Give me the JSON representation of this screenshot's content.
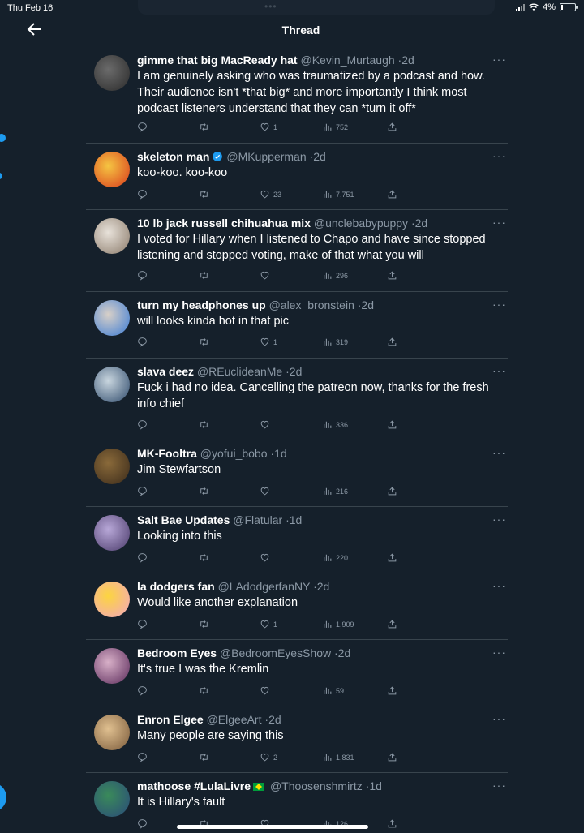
{
  "status_bar": {
    "time": "Thu Feb 16",
    "battery": "4%"
  },
  "header": {
    "title": "Thread"
  },
  "colors": {
    "background": "#15202b",
    "accent": "#1d9bf0",
    "muted": "#8b98a5",
    "divider": "#38444d"
  },
  "tweets": [
    {
      "name": "gimme that big MacReady hat",
      "handle": "@Kevin_Murtaugh",
      "time": "2d",
      "text": "I am genuinely asking who was traumatized by a podcast and how. Their audience isn't *that big* and more importantly I think most podcast listeners understand that they can *turn it off*",
      "likes": "1",
      "views": "752",
      "avatar_colors": [
        "#6b6b6b",
        "#2a2a2a"
      ]
    },
    {
      "name": "skeleton man",
      "verified": true,
      "handle": "@MKupperman",
      "time": "2d",
      "text": "koo-koo. koo-koo",
      "likes": "23",
      "views": "7,751",
      "avatar_colors": [
        "#f5c542",
        "#d93a1c"
      ]
    },
    {
      "name": "10 lb jack russell chihuahua mix",
      "handle": "@unclebabypuppy",
      "time": "2d",
      "text": "I voted for Hillary when I listened to Chapo and have since stopped listening and stopped voting, make of that what you will",
      "likes": "",
      "views": "296",
      "avatar_colors": [
        "#e8e2da",
        "#8a7a6a"
      ]
    },
    {
      "name": "turn my headphones up",
      "handle": "@alex_bronstein",
      "time": "2d",
      "text": "will looks kinda hot in that pic",
      "likes": "1",
      "views": "319",
      "avatar_colors": [
        "#d8d0c8",
        "#3a7bd5"
      ]
    },
    {
      "name": "slava deez",
      "handle": "@REuclideanMe",
      "time": "2d",
      "text": "Fuck i had no idea. Cancelling the patreon now, thanks for the fresh info chief",
      "likes": "",
      "views": "336",
      "avatar_colors": [
        "#c9d6df",
        "#2e4a6b"
      ]
    },
    {
      "name": "MK-Fooltra",
      "handle": "@yofui_bobo",
      "time": "1d",
      "text": "Jim Stewfartson",
      "likes": "",
      "views": "216",
      "avatar_colors": [
        "#8a6a3a",
        "#3a2a1a"
      ]
    },
    {
      "name": "Salt Bae Updates",
      "handle": "@Flatular",
      "time": "1d",
      "text": "Looking into this",
      "likes": "",
      "views": "220",
      "avatar_colors": [
        "#b8a8d8",
        "#4a3a6a"
      ]
    },
    {
      "name": "la dodgers fan",
      "handle": "@LAdodgerfanNY",
      "time": "2d",
      "text": "Would like another explanation",
      "likes": "1",
      "views": "1,909",
      "avatar_colors": [
        "#fcd53f",
        "#f3a6c0"
      ]
    },
    {
      "name": "Bedroom Eyes",
      "handle": "@BedroomEyesShow",
      "time": "2d",
      "text": "It's true I was the Kremlin",
      "likes": "",
      "views": "59",
      "avatar_colors": [
        "#d8b0c8",
        "#5a2a5a"
      ]
    },
    {
      "name": "Enron Elgee",
      "handle": "@ElgeeArt",
      "time": "2d",
      "text": "Many people are saying this",
      "likes": "2",
      "views": "1,831",
      "avatar_colors": [
        "#e0c090",
        "#7a5a3a"
      ]
    },
    {
      "name": "mathoose #LulaLivre",
      "flag": true,
      "handle": "@Thoosenshmirtz",
      "time": "1d",
      "text": "It is Hillary's fault",
      "likes": "",
      "views": "126",
      "avatar_colors": [
        "#3a8a5a",
        "#2a4a7a"
      ]
    }
  ]
}
